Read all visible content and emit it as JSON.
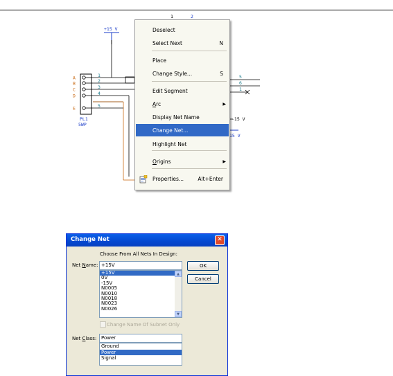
{
  "schematic": {
    "top_labels": [
      "1",
      "2"
    ],
    "power_pos_label": "+15 V",
    "pin_letters": [
      "A",
      "B",
      "C",
      "D",
      "E"
    ],
    "pin_numbers": [
      "1",
      "2",
      "3",
      "4",
      "5"
    ],
    "connector_ref": "PL1",
    "connector_type": "5WP",
    "right_numbers": [
      "5",
      "6",
      "1"
    ],
    "neg_label": "-15 V",
    "neg_label_2": "15 V"
  },
  "context_menu": {
    "items": [
      {
        "label": "Deselect",
        "shortcut": ""
      },
      {
        "label": "Select Next",
        "shortcut": "N"
      },
      {
        "label": "Place",
        "shortcut": ""
      },
      {
        "label": "Change Style...",
        "shortcut": "S"
      },
      {
        "label": "Edit Segment",
        "shortcut": ""
      },
      {
        "label": "Arc",
        "shortcut": "",
        "submenu": true
      },
      {
        "label": "Display Net Name",
        "shortcut": ""
      },
      {
        "label": "Change Net...",
        "shortcut": "",
        "highlighted": true
      },
      {
        "label": "Highlight Net",
        "shortcut": ""
      },
      {
        "label": "Origins",
        "shortcut": "",
        "submenu": true
      },
      {
        "label": "Properties...",
        "shortcut": "Alt+Enter",
        "icon": "properties-icon"
      }
    ]
  },
  "dialog": {
    "title": "Change Net",
    "close_glyph": "✕",
    "choose_label": "Choose From All Nets In Design:",
    "net_name_label": "Net Name:",
    "net_name_value": "+15V",
    "nets": [
      "+15V",
      "0V",
      "-15V",
      "N0005",
      "N0010",
      "N0018",
      "N0023",
      "N0026"
    ],
    "selected_net": "+15V",
    "ok_label": "OK",
    "cancel_label": "Cancel",
    "subnet_checkbox_label": "Change Name Of Subnet Only",
    "net_class_label": "Net Class:",
    "net_class_value": "Power",
    "classes": [
      "Ground",
      "Power",
      "Signal"
    ],
    "selected_class": "Power"
  }
}
